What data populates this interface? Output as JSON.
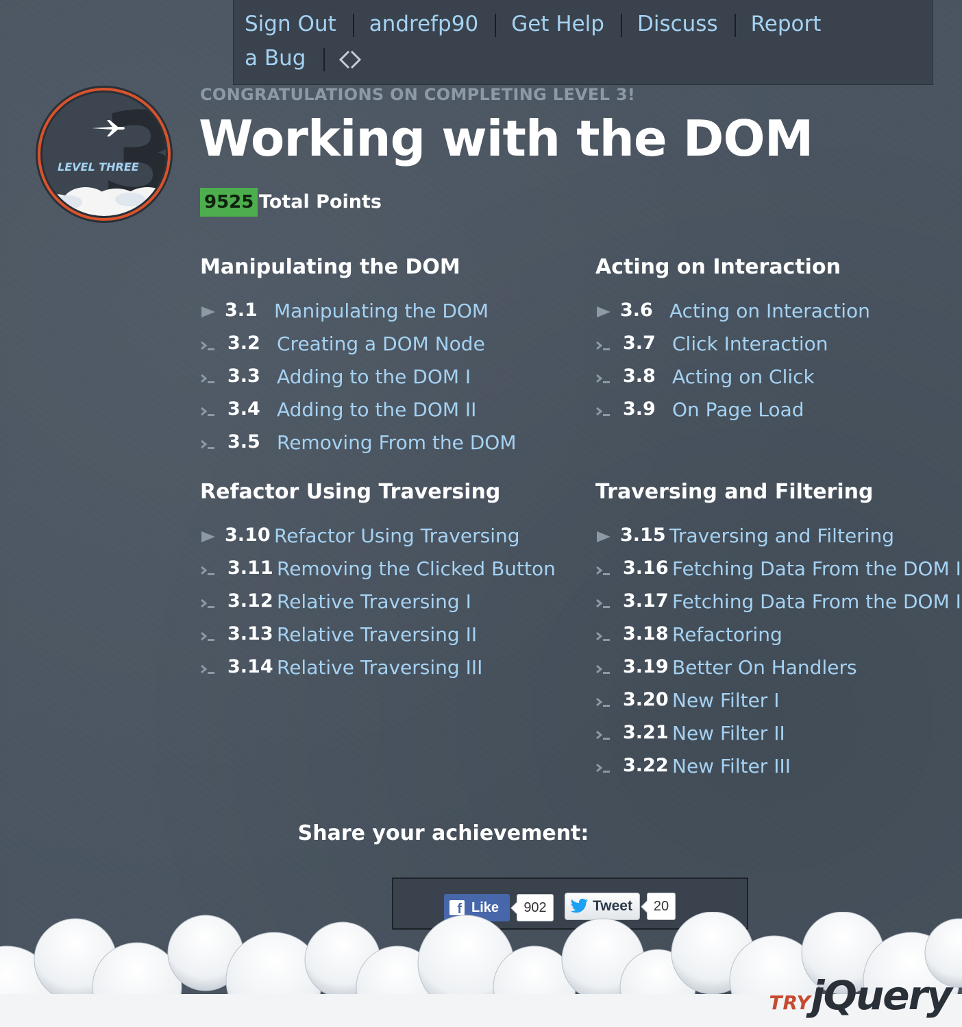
{
  "nav": {
    "items": [
      "Sign Out",
      "andrefp90",
      "Get Help",
      "Discuss",
      "Report"
    ],
    "wrap_item": "a Bug",
    "code_icon": "code-icon"
  },
  "badge": {
    "number": "3",
    "label": "LEVEL THREE",
    "icon": "airplane-icon",
    "ring_color": "#d9532c"
  },
  "header": {
    "congrats": "CONGRATULATIONS ON COMPLETING LEVEL 3!",
    "title": "Working with the DOM",
    "points": "9525",
    "points_label": "Total Points",
    "points_color": "#4cae4c"
  },
  "sections": [
    {
      "title": "Manipulating the DOM",
      "lessons": [
        {
          "num": "3.1",
          "name": "Manipulating the DOM",
          "marker": "play-icon"
        },
        {
          "num": "3.2",
          "name": "Creating a DOM Node",
          "marker": "prompt-icon"
        },
        {
          "num": "3.3",
          "name": "Adding to the DOM I",
          "marker": "prompt-icon"
        },
        {
          "num": "3.4",
          "name": "Adding to the DOM II",
          "marker": "prompt-icon"
        },
        {
          "num": "3.5",
          "name": "Removing From the DOM",
          "marker": "prompt-icon"
        }
      ]
    },
    {
      "title": "Acting on Interaction",
      "lessons": [
        {
          "num": "3.6",
          "name": "Acting on Interaction",
          "marker": "play-icon"
        },
        {
          "num": "3.7",
          "name": "Click Interaction",
          "marker": "prompt-icon"
        },
        {
          "num": "3.8",
          "name": "Acting on Click",
          "marker": "prompt-icon"
        },
        {
          "num": "3.9",
          "name": "On Page Load",
          "marker": "prompt-icon"
        }
      ]
    },
    {
      "title": "Refactor Using Traversing",
      "lessons": [
        {
          "num": "3.10",
          "name": "Refactor Using Traversing",
          "marker": "play-icon"
        },
        {
          "num": "3.11",
          "name": "Removing the Clicked Button",
          "marker": "prompt-icon"
        },
        {
          "num": "3.12",
          "name": "Relative Traversing I",
          "marker": "prompt-icon"
        },
        {
          "num": "3.13",
          "name": "Relative Traversing II",
          "marker": "prompt-icon"
        },
        {
          "num": "3.14",
          "name": "Relative Traversing III",
          "marker": "prompt-icon"
        }
      ]
    },
    {
      "title": "Traversing and Filtering",
      "lessons": [
        {
          "num": "3.15",
          "name": "Traversing and Filtering",
          "marker": "play-icon"
        },
        {
          "num": "3.16",
          "name": "Fetching Data From the DOM I",
          "marker": "prompt-icon"
        },
        {
          "num": "3.17",
          "name": "Fetching Data From the DOM II",
          "marker": "prompt-icon"
        },
        {
          "num": "3.18",
          "name": "Refactoring",
          "marker": "prompt-icon"
        },
        {
          "num": "3.19",
          "name": "Better On Handlers",
          "marker": "prompt-icon"
        },
        {
          "num": "3.20",
          "name": "New Filter I",
          "marker": "prompt-icon"
        },
        {
          "num": "3.21",
          "name": "New Filter II",
          "marker": "prompt-icon"
        },
        {
          "num": "3.22",
          "name": "New Filter III",
          "marker": "prompt-icon"
        }
      ]
    }
  ],
  "share": {
    "title": "Share your achievement:",
    "like_label": "Like",
    "like_count": "902",
    "tweet_label": "Tweet",
    "tweet_count": "20",
    "facebook_color": "#4867aa",
    "twitter_color": "#1da1f2"
  },
  "footer": {
    "logo_try": "TRY",
    "logo_name": "jQuery",
    "logo_accent": "#c64a2f"
  }
}
